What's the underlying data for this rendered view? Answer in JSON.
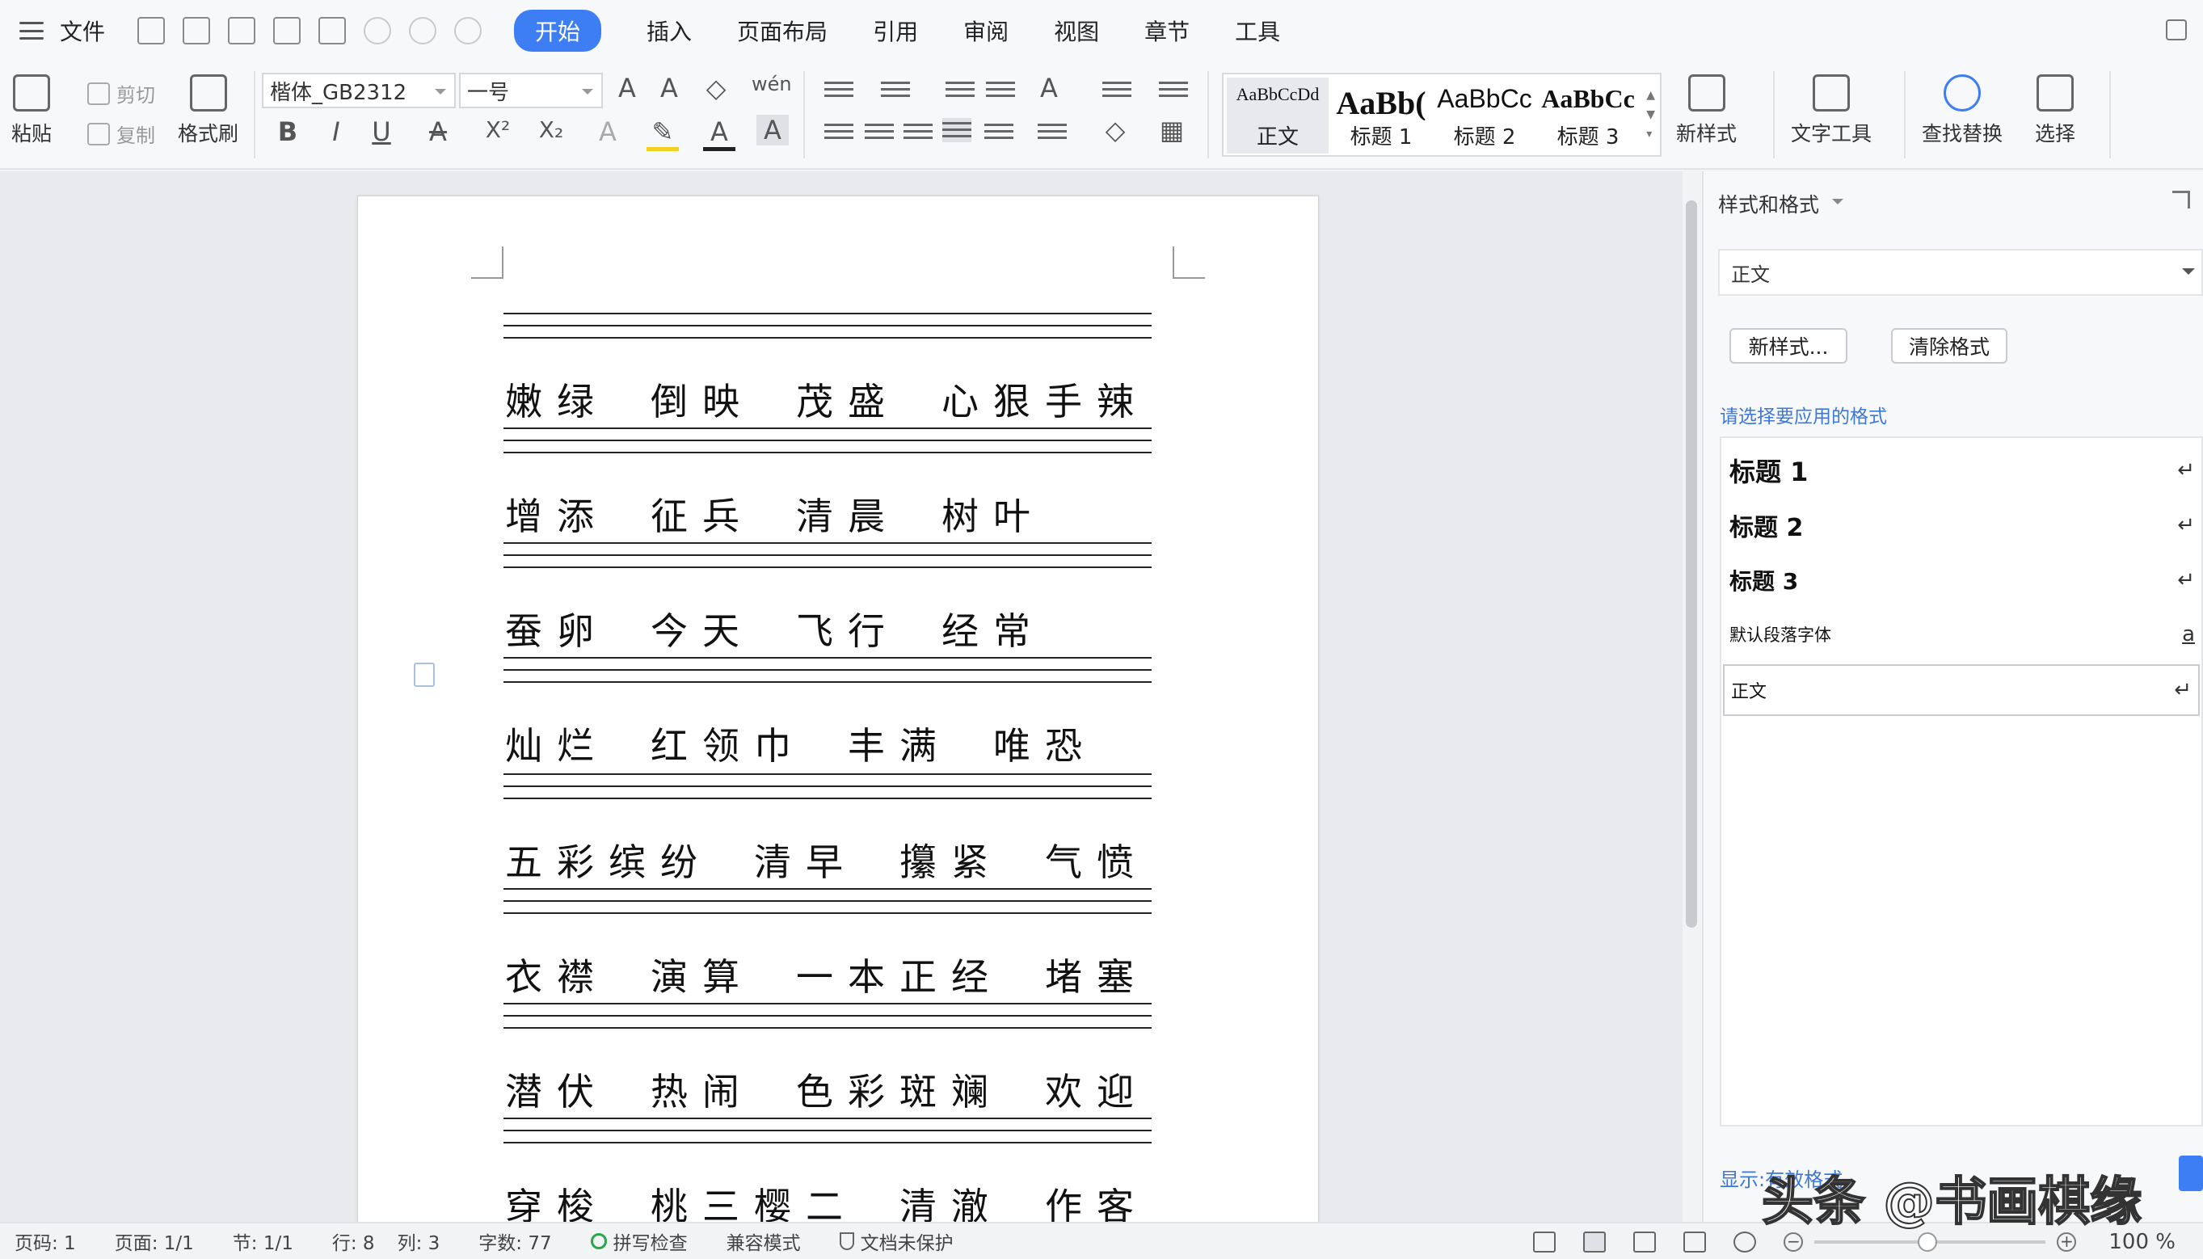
{
  "menubar": {
    "file": "文件",
    "tabs": [
      "开始",
      "插入",
      "页面布局",
      "引用",
      "审阅",
      "视图",
      "章节",
      "工具"
    ],
    "active_tab": "开始"
  },
  "ribbon": {
    "paste": "粘贴",
    "cut": "剪切",
    "copy": "复制",
    "format_painter": "格式刷",
    "font_family": "楷体_GB2312",
    "font_size": "一号",
    "format_buttons": [
      "B",
      "I",
      "U",
      "A",
      "X²",
      "X₂",
      "A",
      "A",
      "A"
    ],
    "styles": [
      {
        "preview": "AaBbCcDd",
        "name": "正文"
      },
      {
        "preview": "AaBb(",
        "name": "标题 1"
      },
      {
        "preview": "AaBbCc",
        "name": "标题 2"
      },
      {
        "preview": "AaBbCc",
        "name": "标题 3"
      }
    ],
    "new_style": "新样式",
    "text_tools": "文字工具",
    "find_replace": "查找替换",
    "select": "选择"
  },
  "document": {
    "rows": [
      [
        "嫩绿",
        "倒映",
        "茂盛",
        "心狠手辣"
      ],
      [
        "增添",
        "征兵",
        "清晨",
        "树叶"
      ],
      [
        "蚕卵",
        "今天",
        "飞行",
        "经常"
      ],
      [
        "灿烂",
        "红领巾",
        "丰满",
        "唯恐"
      ],
      [
        "五彩缤纷",
        "清早",
        "攥紧",
        "气愤"
      ],
      [
        "衣襟",
        "演算",
        "一本正经",
        "堵塞"
      ],
      [
        "潜伏",
        "热闹",
        "色彩斑斓",
        "欢迎"
      ],
      [
        "穿梭",
        "桃三樱二",
        "清澈",
        "作客"
      ]
    ]
  },
  "panel": {
    "title": "样式和格式",
    "current_style": "正文",
    "new_style_btn": "新样式...",
    "clear_format_btn": "清除格式",
    "hint": "请选择要应用的格式",
    "list": [
      {
        "name": "标题 1",
        "mark": "↵"
      },
      {
        "name": "标题 2",
        "mark": "↵"
      },
      {
        "name": "标题 3",
        "mark": "↵"
      },
      {
        "name": "默认段落字体",
        "mark": "a"
      },
      {
        "name": "正文",
        "mark": "↵"
      }
    ],
    "footer": "显示:有效格式"
  },
  "status": {
    "page_code": "页码: 1",
    "page": "页面: 1/1",
    "section": "节: 1/1",
    "line": "行: 8",
    "col": "列: 3",
    "word_count": "字数: 77",
    "spell_check": "拼写检查",
    "compat": "兼容模式",
    "protect": "文档未保护",
    "zoom": "100 %"
  },
  "watermark": "头条 @书画棋缘"
}
